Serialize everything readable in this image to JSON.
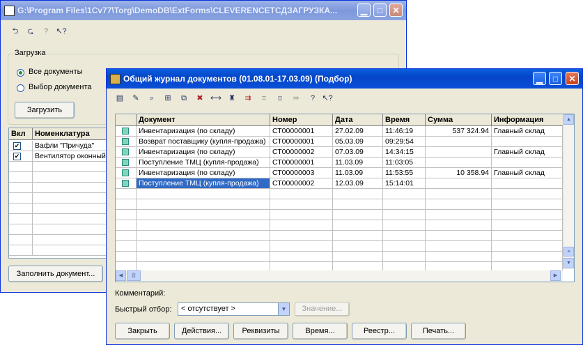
{
  "back_window": {
    "title": "G:\\Program Files\\1Cv77\\Torg\\DemoDB\\ExtForms\\CLEVERENCETCДЗАГРУЗКА...",
    "toolbar_icons": [
      "arrow-left-icon",
      "arrow-right-icon",
      "help-icon",
      "pointer-help-icon"
    ],
    "group_label": "Загрузка",
    "radio_all": "Все документы",
    "radio_select": "Выбор документа",
    "load_button": "Загрузить",
    "table": {
      "headers": [
        "Вкл",
        "Номенклатура"
      ],
      "rows": [
        {
          "checked": true,
          "name": "Вафли \"Причуда\""
        },
        {
          "checked": true,
          "name": "Вентилятор оконный"
        }
      ]
    },
    "fill_button": "Заполнить документ..."
  },
  "front_window": {
    "title": "Общий журнал документов (01.08.01-17.03.09) (Подбор)",
    "toolbar_icons": [
      "new-icon",
      "edit-icon",
      "find-icon",
      "add-row-icon",
      "copy-icon",
      "delete-icon",
      "range-icon",
      "tree-icon",
      "post-icon",
      "filter-icon",
      "filter-off-icon",
      "arrow-icon",
      "help-icon",
      "pointer-help-icon"
    ],
    "table": {
      "headers": [
        "Документ",
        "Номер",
        "Дата",
        "Время",
        "Сумма",
        "Информация"
      ],
      "rows": [
        [
          "Инвентаризация (по складу)",
          "СТ00000001",
          "27.02.09",
          "11:46:19",
          "537 324.94",
          "Главный склад"
        ],
        [
          "Возврат поставщику (купля-продажа)",
          "СТ00000001",
          "05.03.09",
          "09:29:54",
          "",
          ""
        ],
        [
          "Инвентаризация (по складу)",
          "СТ00000002",
          "07.03.09",
          "14:34:15",
          "",
          "Главный склад"
        ],
        [
          "Поступление ТМЦ (купля-продажа)",
          "СТ00000001",
          "11.03.09",
          "11:03:05",
          "",
          ""
        ],
        [
          "Инвентаризация (по складу)",
          "СТ00000003",
          "11.03.09",
          "11:53:55",
          "10 358.94",
          "Главный склад"
        ],
        [
          "Поступление ТМЦ (купля-продажа)",
          "СТ00000002",
          "12.03.09",
          "15:14:01",
          "",
          ""
        ]
      ],
      "selected_row": 5
    },
    "comment_label": "Комментарий:",
    "quick_filter_label": "Быстрый отбор:",
    "quick_filter_value": "< отсутствует >",
    "value_button": "Значение...",
    "buttons": {
      "close": "Закрыть",
      "actions": "Действия...",
      "attributes": "Реквизиты",
      "time": "Время...",
      "registry": "Реестр...",
      "print": "Печать..."
    }
  }
}
